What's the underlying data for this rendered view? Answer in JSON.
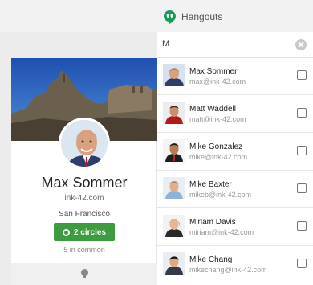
{
  "header": {
    "app_title": "Hangouts",
    "icon": "hangouts-quote-icon",
    "accent": "#0f9d58"
  },
  "search": {
    "value": "M",
    "clear_icon": "clear-icon"
  },
  "profile": {
    "name": "Max Sommer",
    "domain": "ink-42.com",
    "location": "San Francisco",
    "circles_label": "2 circles",
    "common_label": "5 in common",
    "button_color": "#3d9c3d"
  },
  "contacts": [
    {
      "name": "Max Sommer",
      "email": "max@ink-42.com",
      "checked": false
    },
    {
      "name": "Matt Waddell",
      "email": "matt@ink-42.com",
      "checked": false
    },
    {
      "name": "Mike Gonzalez",
      "email": "mike@ink-42.com",
      "checked": false
    },
    {
      "name": "Mike Baxter",
      "email": "mikeb@ink-42.com",
      "checked": false
    },
    {
      "name": "Miriam Davis",
      "email": "miriam@ink-42.com",
      "checked": false
    },
    {
      "name": "Mike Chang",
      "email": "mikechang@ink-42.com",
      "checked": false
    }
  ]
}
